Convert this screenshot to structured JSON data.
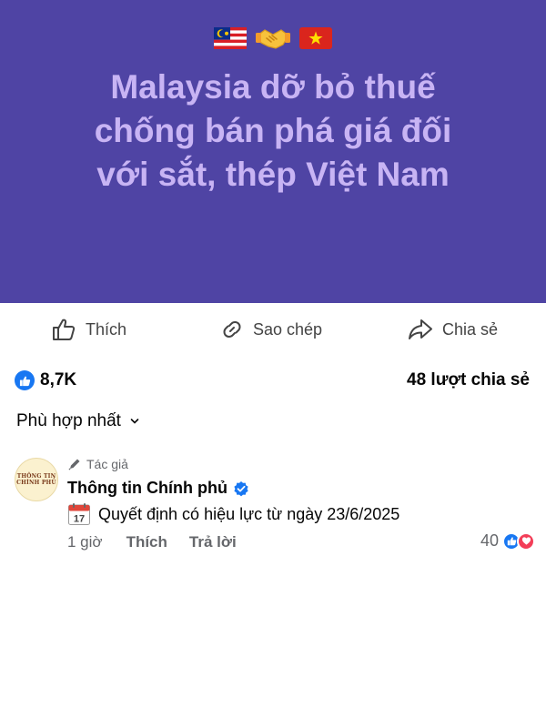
{
  "banner": {
    "emojis": [
      "malaysia-flag-icon",
      "handshake-icon",
      "vietnam-flag-icon"
    ],
    "headline_lines": [
      "Malaysia dỡ bỏ thuế",
      "chống bán phá giá đối",
      "với sắt, thép Việt Nam"
    ],
    "background_color": "#4f44a4",
    "text_color": "#c8b4f4"
  },
  "actions": {
    "like_label": "Thích",
    "copy_label": "Sao chép",
    "share_label": "Chia sẻ"
  },
  "stats": {
    "reaction_count": "8,7K",
    "share_count": "48 lượt chia sẻ"
  },
  "sort": {
    "label": "Phù hợp nhất"
  },
  "comment": {
    "author_tag": "Tác giả",
    "author_name": "Thông tin Chính phủ",
    "avatar_text": [
      "THÔNG TIN",
      "CHÍNH PHỦ"
    ],
    "calendar_day": "17",
    "text": "Quyết định có hiệu lực từ ngày 23/6/2025",
    "time": "1 giờ",
    "like_label": "Thích",
    "reply_label": "Trả lời",
    "reaction_count": "40"
  },
  "colors": {
    "accent": "#1877f2",
    "love": "#f33e58",
    "secondary_text": "#65676b"
  }
}
